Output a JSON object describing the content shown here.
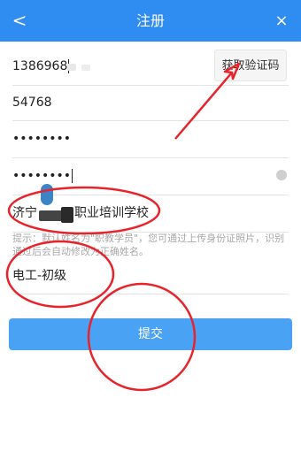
{
  "header": {
    "title": "注册",
    "back_glyph": "<",
    "close_glyph": "×",
    "background": "#2f8cf0"
  },
  "form": {
    "phone_value": "1386968",
    "code_value": "54768",
    "password_value": "••••••••",
    "confirm_password_value": "••••••••",
    "school_prefix": "济宁",
    "school_suffix": "职业培训学校",
    "hint": "提示：默认姓名为\"职教学员\"，您可通过上传身份证照片，识别通过后会自动修改为正确姓名。",
    "course_value": "电工-初级",
    "get_code_label": "获取验证码",
    "submit_label": "提交"
  },
  "annotation_color": "#e8232b"
}
